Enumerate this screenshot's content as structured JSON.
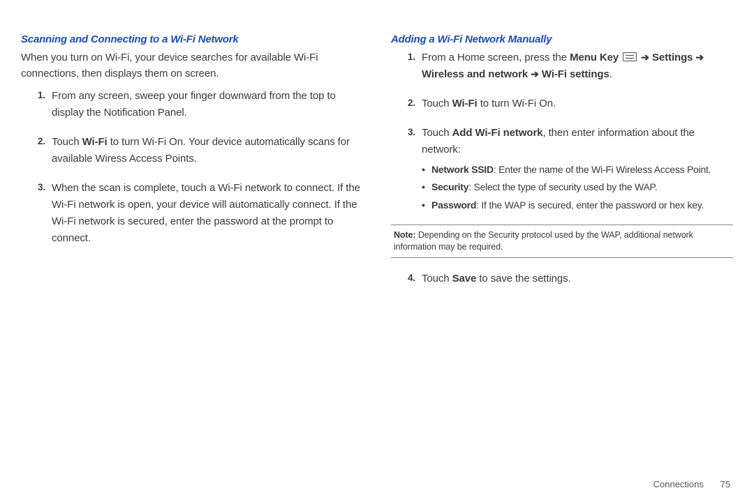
{
  "left": {
    "heading": "Scanning and Connecting to a Wi-Fi Network",
    "intro": "When you turn on Wi-Fi, your device searches for available Wi-Fi connections, then displays them on screen.",
    "items": [
      {
        "num": "1.",
        "text": "From any screen, sweep your finger downward from the top to display the Notification Panel."
      },
      {
        "num": "2.",
        "pre": "Touch ",
        "bold1": "Wi-Fi",
        "post": " to turn Wi-Fi On. Your device automatically scans for available Wiress Access Points."
      },
      {
        "num": "3.",
        "text": "When the scan is complete, touch a Wi-Fi network to connect. If the Wi-Fi network is open, your device will automatically connect. If the Wi-Fi network is secured, enter the password at the prompt to connect."
      }
    ]
  },
  "right": {
    "heading": "Adding a Wi-Fi Network Manually",
    "items": {
      "i1": {
        "num": "1.",
        "pre": "From a Home screen, press the ",
        "menukey": "Menu Key",
        "arrow": "➔",
        "settings": "Settings",
        "wireless": "Wireless and network",
        "wifisettings": "Wi-Fi settings",
        "period": "."
      },
      "i2": {
        "num": "2.",
        "pre": "Touch ",
        "bold": "Wi-Fi",
        "post": " to turn Wi-Fi On."
      },
      "i3": {
        "num": "3.",
        "pre": "Touch ",
        "bold": "Add Wi-Fi network",
        "post": ", then enter information about the network:",
        "sub": [
          {
            "label": "Network SSID",
            "text": ": Enter the name of the Wi-Fi Wireless Access Point."
          },
          {
            "label": "Security",
            "text": ": Select the type of security used by the WAP."
          },
          {
            "label": "Password",
            "text": ": If the WAP is secured, enter the password or hex key."
          }
        ]
      },
      "i4": {
        "num": "4.",
        "pre": "Touch ",
        "bold": "Save",
        "post": "  to save the settings."
      }
    },
    "note": {
      "label": "Note:",
      "text": " Depending on the Security protocol used by the WAP, additional network information may be required."
    }
  },
  "footer": {
    "section": "Connections",
    "page": "75"
  }
}
